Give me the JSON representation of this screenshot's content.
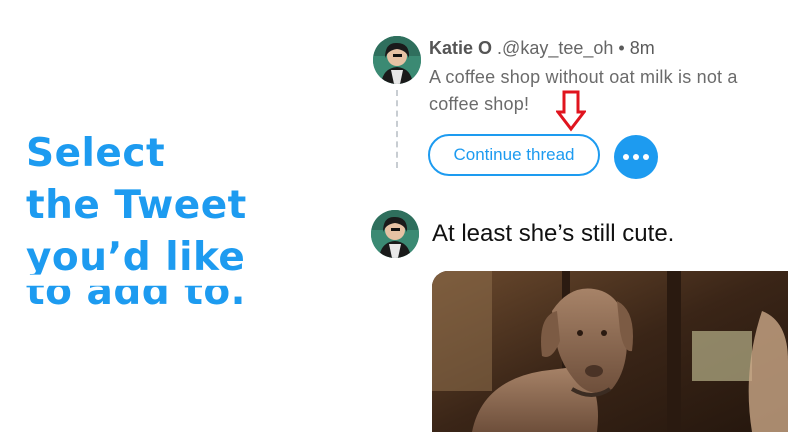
{
  "promo": {
    "lines": [
      "Select",
      "the Tweet",
      "you’d like",
      "to add to."
    ]
  },
  "tweet1": {
    "name": "Katie O",
    "handle": ".@kay_tee_oh",
    "separator": "•",
    "time": "8m",
    "text": "A coffee shop without oat milk is not a coffee shop!",
    "avatar_icon": "avatar-photo"
  },
  "actions": {
    "continue_label": "Continue thread",
    "more_icon": "more-dots-icon"
  },
  "annotation": {
    "icon": "down-arrow-icon",
    "color": "#e0141e"
  },
  "tweet2": {
    "text": "At least she’s still cute.",
    "media_description_icon": "dog-photo"
  },
  "colors": {
    "accent": "#1d9bf0"
  }
}
